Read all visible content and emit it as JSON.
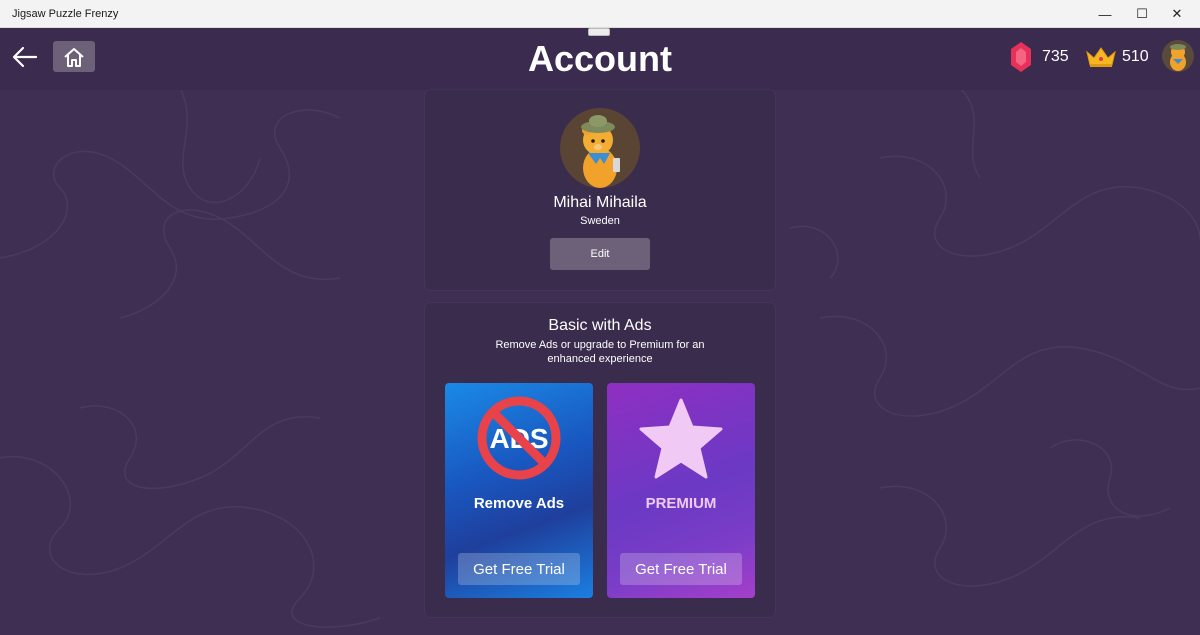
{
  "window": {
    "title": "Jigsaw Puzzle Frenzy",
    "controls": {
      "minimize": "—",
      "maximize": "☐",
      "close": "✕"
    }
  },
  "header": {
    "title": "Account",
    "gems": "735",
    "crowns": "510"
  },
  "profile": {
    "name": "Mihai Mihaila",
    "country": "Sweden",
    "edit_label": "Edit"
  },
  "subscription": {
    "title": "Basic with Ads",
    "description": "Remove Ads or upgrade to Premium for an enhanced experience",
    "remove_ads": {
      "badge_text": "ADS",
      "label": "Remove Ads",
      "button": "Get Free Trial"
    },
    "premium": {
      "label": "PREMIUM",
      "button": "Get Free Trial"
    }
  },
  "colors": {
    "background": "#3f2f52",
    "card": "#3a2c4d",
    "button": "#6c6178",
    "gem": "#e8315a",
    "crown": "#f5b820",
    "ads_tile": "#1b6fd6",
    "premium_tile": "#8a35c4"
  }
}
